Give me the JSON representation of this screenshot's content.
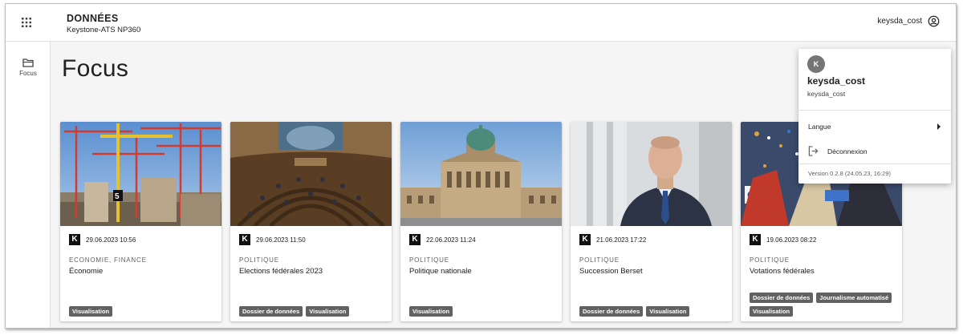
{
  "header": {
    "app_title": "DONNÉES",
    "app_subtitle": "Keystone-ATS NP360",
    "username": "keysda_cost",
    "apps_icon": "apps-grid-icon",
    "account_icon": "account-circle-icon"
  },
  "sidebar": {
    "items": [
      {
        "label": "Focus",
        "icon": "folder-icon"
      }
    ]
  },
  "main": {
    "title": "Focus",
    "cards": [
      {
        "date": "29.06.2023 10:56",
        "category": "ECONOMIE, FINANCE",
        "title": "Économie",
        "tags": [
          "Visualisation"
        ]
      },
      {
        "date": "29.06.2023 11:50",
        "category": "POLITIQUE",
        "title": "Elections fédérales 2023",
        "tags": [
          "Dossier de données",
          "Visualisation"
        ]
      },
      {
        "date": "22.06.2023 11:24",
        "category": "POLITIQUE",
        "title": "Politique nationale",
        "tags": [
          "Visualisation"
        ]
      },
      {
        "date": "21.06.2023 17:22",
        "category": "POLITIQUE",
        "title": "Succession Berset",
        "tags": [
          "Dossier de données",
          "Visualisation"
        ]
      },
      {
        "date": "19.06.2023 08:22",
        "category": "POLITIQUE",
        "title": "Votations fédérales",
        "tags": [
          "Dossier de données",
          "Journalisme automatisé",
          "Visualisation"
        ]
      }
    ],
    "source_logo_letter": "K"
  },
  "user_menu": {
    "avatar_letter": "K",
    "display_name": "keysda_cost",
    "login": "keysda_cost",
    "language_label": "Langue",
    "logout_label": "Déconnexion",
    "version": "Version 0.2.8 (24.05.23, 16:29)"
  },
  "colors": {
    "chip_bg": "#616161",
    "page_bg": "#f5f5f5",
    "topbar_bg": "#ffffff"
  }
}
